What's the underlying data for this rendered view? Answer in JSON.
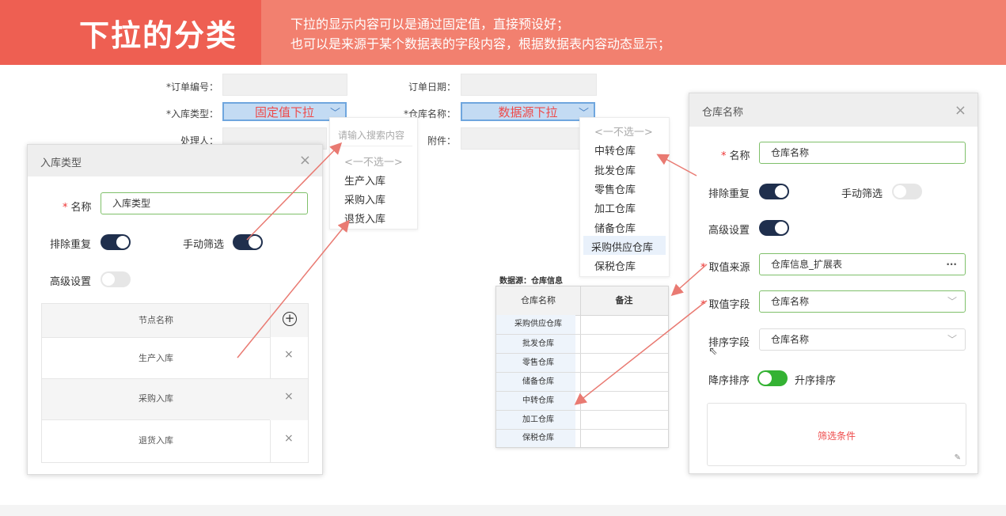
{
  "banner": {
    "title": "下拉的分类",
    "desc_line1": "下拉的显示内容可以是通过固定值，直接预设好；",
    "desc_line2": "也可以是来源于某个数据表的字段内容，根据数据表内容动态显示；"
  },
  "form": {
    "order_no_label": "*订单编号：",
    "inbound_type_label": "*入库类型：",
    "handler_label": "处理人：",
    "order_date_label": "订单日期：",
    "warehouse_label": "*仓库名称：",
    "attachment_label": "附件：",
    "fixed_select_value": "固定值下拉",
    "datasource_select_value": "数据源下拉"
  },
  "fixed_dropdown": {
    "search_placeholder": "请输入搜索内容",
    "items": [
      "<一不选一>",
      "生产入库",
      "采购入库",
      "退货入库"
    ]
  },
  "ds_dropdown": {
    "items": [
      "<一不选一>",
      "中转仓库",
      "批发仓库",
      "零售仓库",
      "加工仓库",
      "储备仓库",
      "采购供应仓库",
      "保税仓库"
    ]
  },
  "left_panel": {
    "title": "入库类型",
    "name_label": "名称",
    "name_value": "入库类型",
    "dedupe_label": "排除重复",
    "manual_filter_label": "手动筛选",
    "advanced_label": "高级设置",
    "table_header": "节点名称",
    "rows": [
      "生产入库",
      "采购入库",
      "退货入库"
    ]
  },
  "ds_table": {
    "caption": "数据源：仓库信息",
    "headers": [
      "仓库名称",
      "备注"
    ],
    "rows": [
      "采购供应仓库",
      "批发仓库",
      "零售仓库",
      "储备仓库",
      "中转仓库",
      "加工仓库",
      "保税仓库"
    ]
  },
  "right_panel": {
    "title": "仓库名称",
    "name_label": "名称",
    "name_value": "仓库名称",
    "dedupe_label": "排除重复",
    "manual_filter_label": "手动筛选",
    "advanced_label": "高级设置",
    "source_label": "取值来源",
    "source_value": "仓库信息_扩展表",
    "field_label": "取值字段",
    "field_value": "仓库名称",
    "sort_label": "排序字段",
    "sort_value": "仓库名称",
    "desc_label": "降序排序",
    "asc_label": "升序排序",
    "filter_label": "筛选条件"
  },
  "colors": {
    "banner": "#f2806f",
    "banner_title": "#ee5f52",
    "accent_red": "#ee4a4a",
    "toggle_on": "#1f2f4d",
    "toggle_green": "#34b233"
  }
}
